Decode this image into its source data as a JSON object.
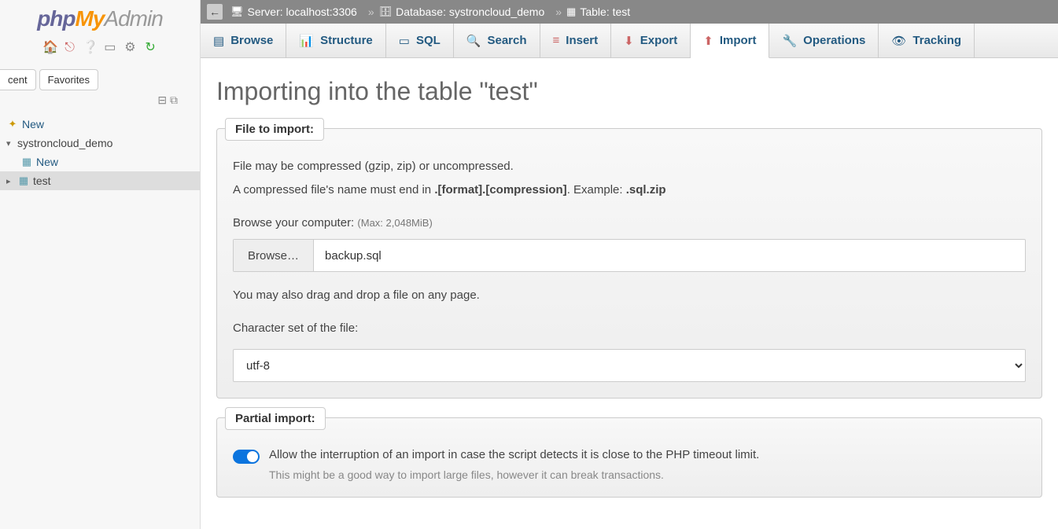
{
  "logo": {
    "part1": "php",
    "part2": "My",
    "part3": "Admin"
  },
  "sidebarIconNames": [
    "home",
    "exit",
    "help",
    "sql",
    "settings",
    "refresh"
  ],
  "sideTabs": {
    "recent": "cent",
    "favorites": "Favorites"
  },
  "tree": {
    "new": "New",
    "db": "systroncloud_demo",
    "dbNew": "New",
    "table": "test"
  },
  "breadcrumb": {
    "server": "Server: localhost:3306",
    "database": "Database: systroncloud_demo",
    "table": "Table: test"
  },
  "tabs": {
    "browse": "Browse",
    "structure": "Structure",
    "sql": "SQL",
    "search": "Search",
    "insert": "Insert",
    "export": "Export",
    "import": "Import",
    "operations": "Operations",
    "tracking": "Tracking"
  },
  "heading": "Importing into the table \"test\"",
  "fileImport": {
    "legend": "File to import:",
    "line1": "File may be compressed (gzip, zip) or uncompressed.",
    "line2a": "A compressed file's name must end in ",
    "line2b": ".[format].[compression]",
    "line2c": ". Example: ",
    "line2d": ".sql.zip",
    "browseLabel": "Browse your computer: ",
    "maxHint": "(Max: 2,048MiB)",
    "browseBtn": "Browse…",
    "fileName": "backup.sql",
    "dragHint": "You may also drag and drop a file on any page.",
    "charsetLabel": "Character set of the file:",
    "charset": "utf-8"
  },
  "partialImport": {
    "legend": "Partial import:",
    "toggleText": "Allow the interruption of an import in case the script detects it is close to the PHP timeout limit.",
    "hint": "This might be a good way to import large files, however it can break transactions."
  }
}
